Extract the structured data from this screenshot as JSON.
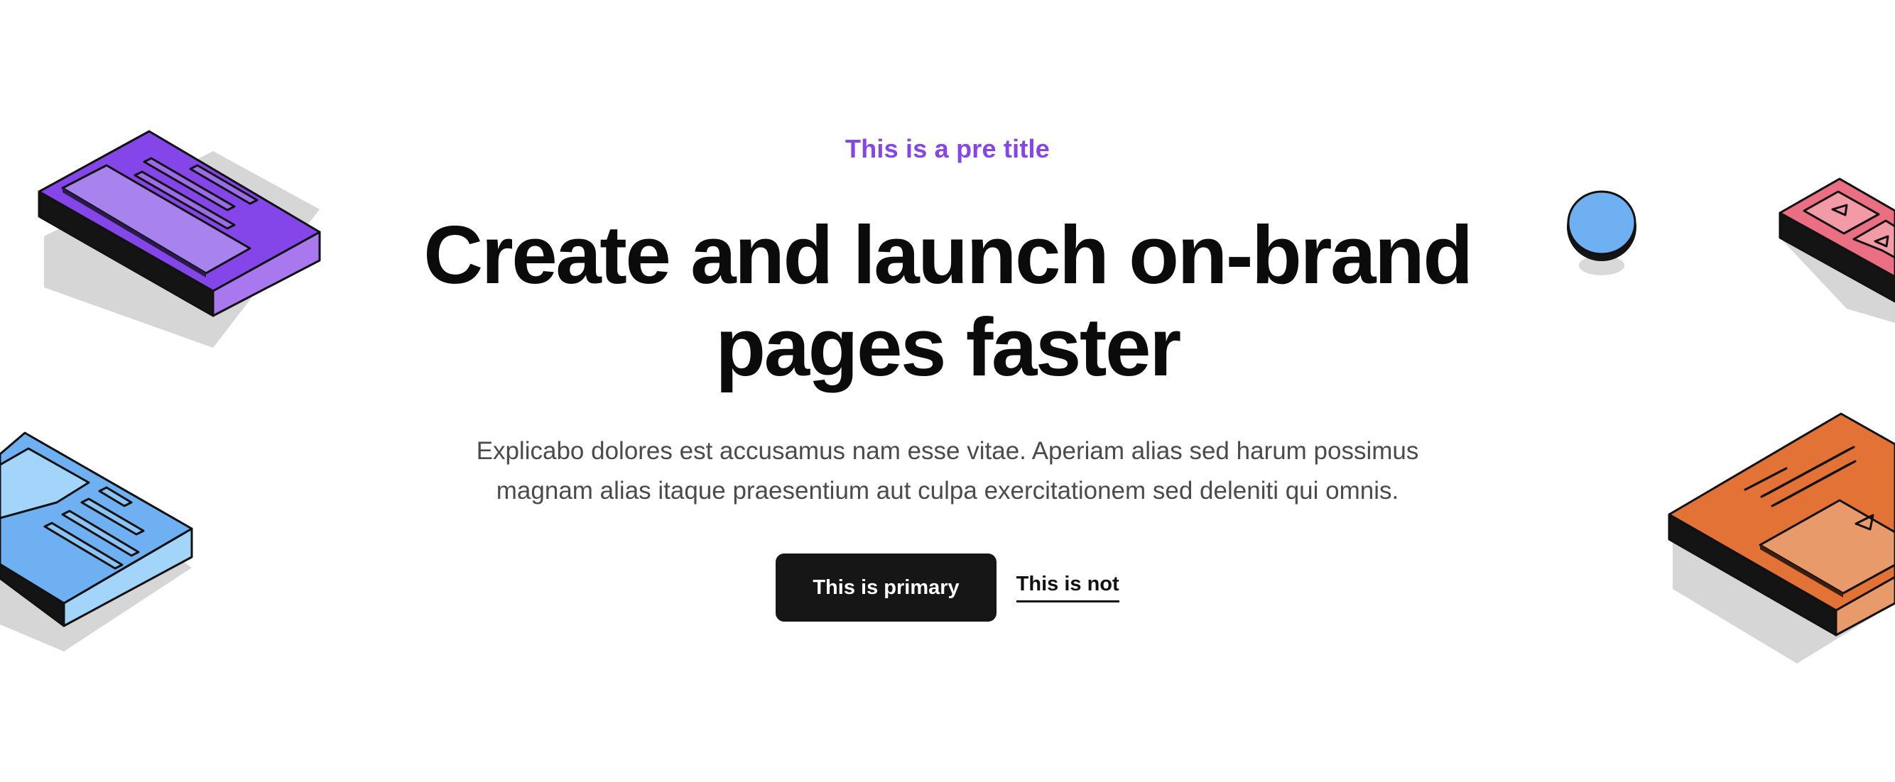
{
  "hero": {
    "pretitle": "This is a pre title",
    "headline": "Create and launch on-brand pages faster",
    "description": "Explicabo dolores est accusamus nam esse vitae. Aperiam alias sed harum possimus magnam alias itaque praesentium aut culpa exercitationem sed deleniti qui omnis.",
    "primary_button": "This is primary",
    "secondary_link": "This is not"
  },
  "illustrations": [
    {
      "name": "purple-isometric-card",
      "color": "#8446e8"
    },
    {
      "name": "blue-isometric-card",
      "color": "#6eb0f2"
    },
    {
      "name": "blue-sphere",
      "color": "#6eb0f2"
    },
    {
      "name": "pink-isometric-card",
      "color": "#ea6f82"
    },
    {
      "name": "orange-isometric-card",
      "color": "#e27235"
    }
  ],
  "colors": {
    "accent": "#8446e8",
    "text": "#0b0b0b",
    "body_text": "#4b4b4b",
    "button_bg": "#161616",
    "background": "#ffffff"
  }
}
